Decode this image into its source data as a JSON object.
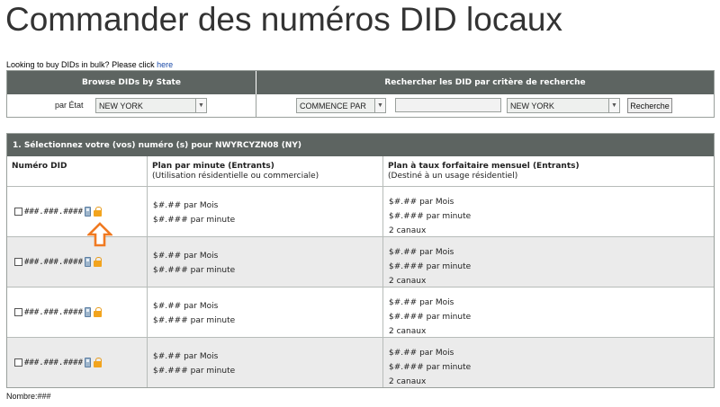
{
  "title": "Commander des numéros DID locaux",
  "bulk": {
    "text": "Looking to buy DIDs in bulk? Please click ",
    "link": "here"
  },
  "search": {
    "left_header": "Browse DIDs by State",
    "right_header": "Rechercher les DID par critère de recherche",
    "state_label": "par État",
    "state_value": "NEW YORK",
    "criteria_value": "COMMENCE PAR",
    "criteria_input_value": "",
    "state2_value": "NEW YORK",
    "search_button": "Recherche"
  },
  "results": {
    "header": "1. Sélectionnez votre (vos) numéro (s) pour NWYRCYZN08 (NY)",
    "columns": {
      "did": "Numéro DID",
      "per_minute_title": "Plan par minute (Entrants)",
      "per_minute_sub": "(Utilisation résidentielle ou commerciale)",
      "flat_title": "Plan à taux forfaitaire mensuel (Entrants)",
      "flat_sub": "(Destiné à un usage résidentiel)"
    },
    "rows": [
      {
        "did": "###.###.####",
        "pm_month": "$#.## par Mois",
        "pm_minute": "$#.### par minute",
        "flat_month": "$#.## par Mois",
        "flat_minute": "$#.### par minute",
        "flat_channels": "2 canaux"
      },
      {
        "did": "###.###.####",
        "pm_month": "$#.## par Mois",
        "pm_minute": "$#.### par minute",
        "flat_month": "$#.## par Mois",
        "flat_minute": "$#.### par minute",
        "flat_channels": "2 canaux"
      },
      {
        "did": "###.###.####",
        "pm_month": "$#.## par Mois",
        "pm_minute": "$#.### par minute",
        "flat_month": "$#.## par Mois",
        "flat_minute": "$#.### par minute",
        "flat_channels": "2 canaux"
      },
      {
        "did": "###.###.####",
        "pm_month": "$#.## par Mois",
        "pm_minute": "$#.### par minute",
        "flat_month": "$#.## par Mois",
        "flat_minute": "$#.### par minute",
        "flat_channels": "2 canaux"
      }
    ]
  },
  "footer": "Nombre:###",
  "icons": {
    "phone": "phone-icon",
    "lock": "lock-icon",
    "highlight": "arrow-up-icon"
  },
  "colors": {
    "header_bg": "#5d6461",
    "accent_arrow": "#f07a22",
    "lock": "#f2a41e"
  }
}
